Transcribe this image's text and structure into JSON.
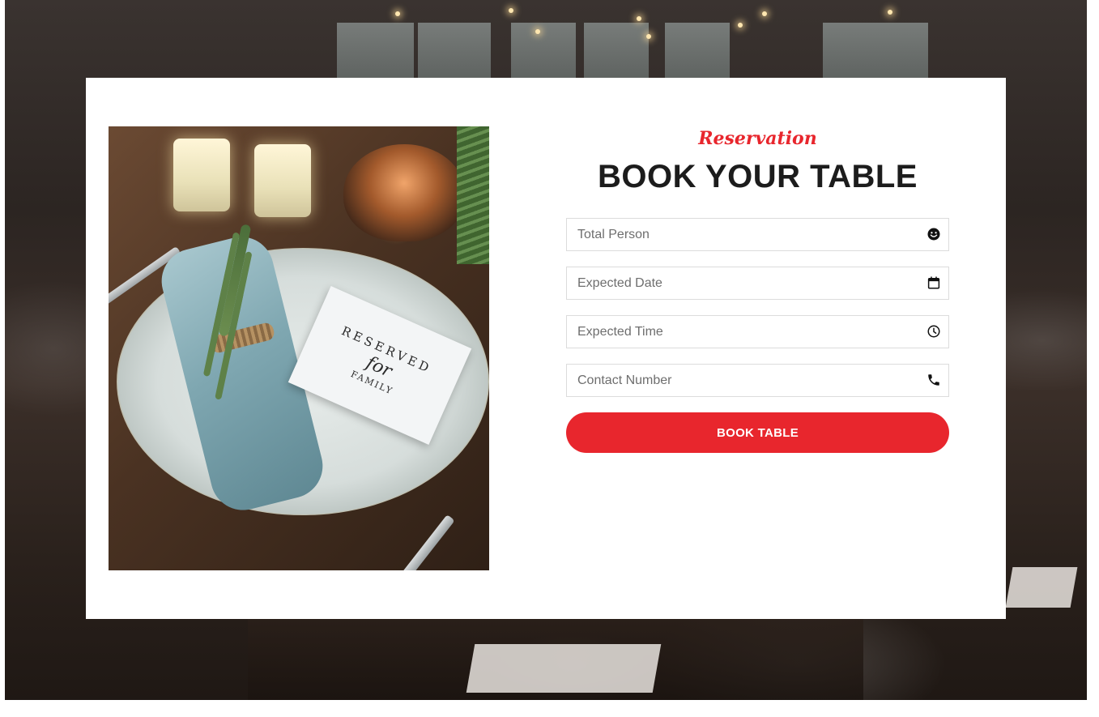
{
  "reservation": {
    "eyebrow": "Reservation",
    "title": "BOOK YOUR TABLE",
    "fields": [
      {
        "placeholder": "Total Person",
        "icon": "smiley-icon"
      },
      {
        "placeholder": "Expected Date",
        "icon": "calendar-icon"
      },
      {
        "placeholder": "Expected Time",
        "icon": "clock-icon"
      },
      {
        "placeholder": "Contact Number",
        "icon": "phone-icon"
      }
    ],
    "submit_label": "BOOK TABLE"
  },
  "photo": {
    "card_line1": "RESERVED",
    "card_line2": "for",
    "card_line3": "FAMILY"
  },
  "colors": {
    "accent": "#e8262d",
    "title": "#1c1c1c",
    "field_border": "#dcdcdc"
  }
}
